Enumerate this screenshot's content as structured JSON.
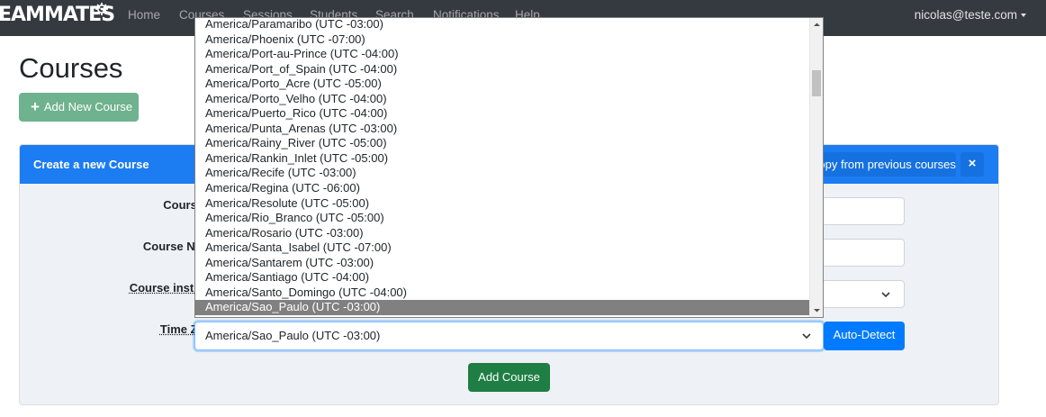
{
  "navbar": {
    "brand": "EAMMATES",
    "items": [
      "Home",
      "Courses",
      "Sessions",
      "Students",
      "Search",
      "Notifications",
      "Help"
    ],
    "user": "nicolas@teste.com"
  },
  "page": {
    "title": "Courses",
    "add_new_course_label": "Add New Course"
  },
  "create_card": {
    "title": "Create a new Course",
    "copy_label": "Copy from previous courses",
    "close_label": "×",
    "course_id_label": "Course ID:",
    "course_name_label": "Course Name:",
    "course_institute_label": "Course institute:",
    "time_zone_label": "Time Zone:",
    "time_zone_value": "America/Sao_Paulo (UTC -03:00)",
    "auto_detect_label": "Auto-Detect",
    "submit_label": "Add Course"
  },
  "timezone_dropdown": {
    "selected": "America/Sao_Paulo (UTC -03:00)",
    "options": [
      "America/Paramaribo (UTC -03:00)",
      "America/Phoenix (UTC -07:00)",
      "America/Port-au-Prince (UTC -04:00)",
      "America/Port_of_Spain (UTC -04:00)",
      "America/Porto_Acre (UTC -05:00)",
      "America/Porto_Velho (UTC -04:00)",
      "America/Puerto_Rico (UTC -04:00)",
      "America/Punta_Arenas (UTC -03:00)",
      "America/Rainy_River (UTC -05:00)",
      "America/Rankin_Inlet (UTC -05:00)",
      "America/Recife (UTC -03:00)",
      "America/Regina (UTC -06:00)",
      "America/Resolute (UTC -05:00)",
      "America/Rio_Branco (UTC -05:00)",
      "America/Rosario (UTC -03:00)",
      "America/Santa_Isabel (UTC -07:00)",
      "America/Santarem (UTC -03:00)",
      "America/Santiago (UTC -04:00)",
      "America/Santo_Domingo (UTC -04:00)",
      "America/Sao_Paulo (UTC -03:00)"
    ],
    "scroll_position": 0.17
  },
  "colors": {
    "navbar_bg": "#343a40",
    "card_header": "#1c7cf2",
    "primary": "#007bff",
    "success": "#1e7e44",
    "selected_option": "#808080"
  }
}
